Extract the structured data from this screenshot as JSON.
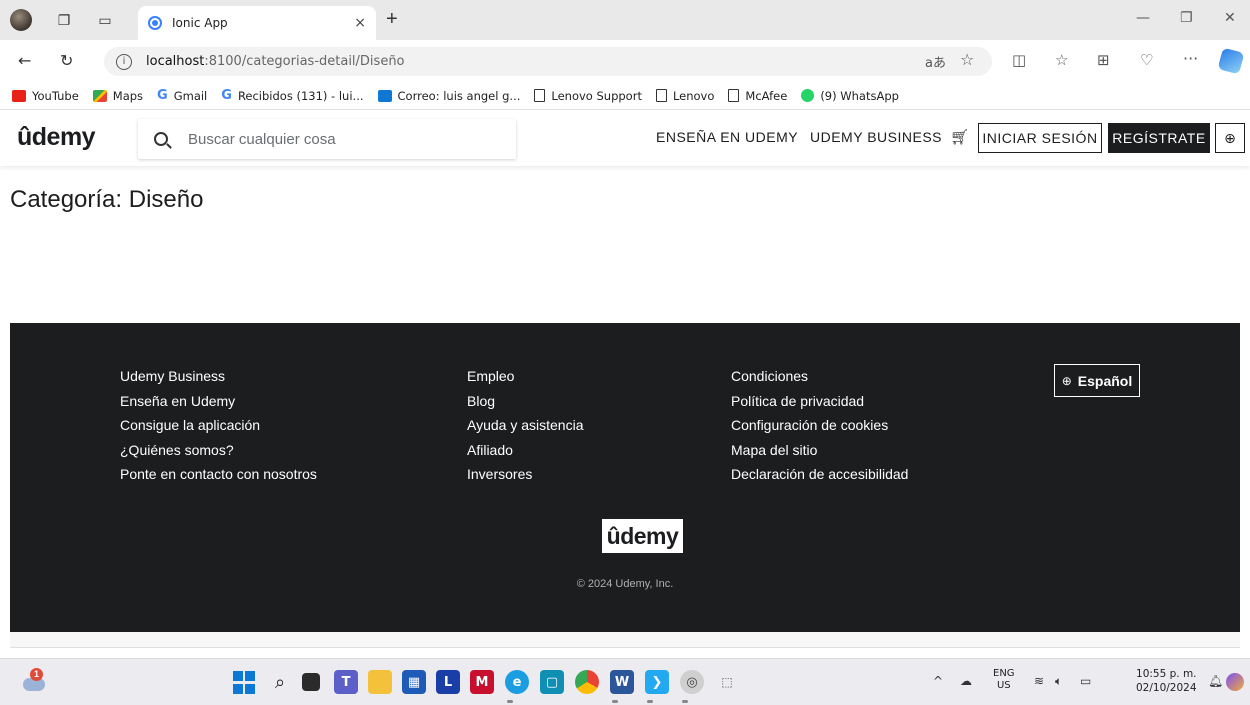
{
  "browser": {
    "tab_title": "Ionic App",
    "tab_close": "×",
    "new_tab": "+",
    "url_host": "localhost",
    "url_path": ":8100/categorias-detail/Diseño",
    "read_aloud": "aあ",
    "bookmarks": [
      {
        "label": "YouTube",
        "icon": "youtube-icon"
      },
      {
        "label": "Maps",
        "icon": "maps-icon"
      },
      {
        "label": "Gmail",
        "icon": "google-icon"
      },
      {
        "label": "Recibidos (131) - lui...",
        "icon": "google-icon"
      },
      {
        "label": "Correo: luis angel g...",
        "icon": "outlook-icon"
      },
      {
        "label": "Lenovo Support",
        "icon": "page-icon"
      },
      {
        "label": "Lenovo",
        "icon": "page-icon"
      },
      {
        "label": "McAfee",
        "icon": "page-icon"
      },
      {
        "label": "(9) WhatsApp",
        "icon": "whatsapp-icon"
      }
    ]
  },
  "header": {
    "logo": "ûdemy",
    "search_placeholder": "Buscar cualquier cosa",
    "teach_link": "ENSEÑA EN UDEMY",
    "business_link": "UDEMY BUSINESS",
    "login_button": "INICIAR SESIÓN",
    "signup_button": "REGÍSTRATE"
  },
  "main": {
    "title": "Categoría: Diseño"
  },
  "footer": {
    "col1": [
      "Udemy Business",
      "Enseña en Udemy",
      "Consigue la aplicación",
      "¿Quiénes somos?",
      "Ponte en contacto con nosotros"
    ],
    "col2": [
      "Empleo",
      "Blog",
      "Ayuda y asistencia",
      "Afiliado",
      "Inversores"
    ],
    "col3": [
      "Condiciones",
      "Política de privacidad",
      "Configuración de cookies",
      "Mapa del sitio",
      "Declaración de accesibilidad"
    ],
    "language_button": "Español",
    "logo": "ûdemy",
    "copyright": "© 2024 Udemy, Inc."
  },
  "taskbar": {
    "weather_badge": "1",
    "lang_line1": "ENG",
    "lang_line2": "US",
    "time": "10:55 p. m.",
    "date": "02/10/2024"
  },
  "colors": {
    "udemy_purple": "#a435f0",
    "udemy_dark": "#1c1d1f",
    "ionic_blue": "#3880ff"
  }
}
